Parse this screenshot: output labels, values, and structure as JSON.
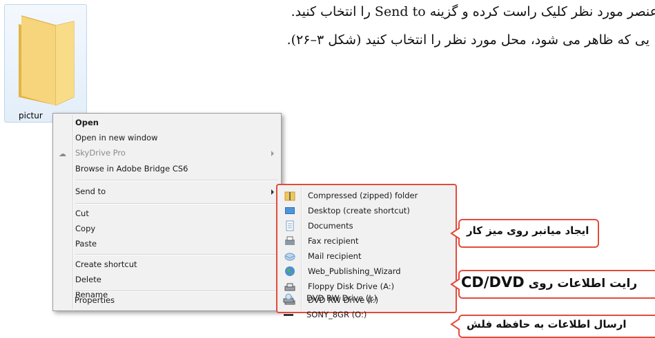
{
  "text": {
    "line1": "عنصر مورد نظر کلیک راست کرده و گزینه Send to را انتخاب کنید.",
    "line2": "یی که ظاهر می شود، محل مورد نظر را انتخاب کنید (شکل ۳–۲۶)."
  },
  "folder": {
    "caption": "pictur",
    "icon": "folder-icon"
  },
  "context_menu": {
    "items": [
      {
        "label": "Open",
        "bold": true
      },
      {
        "label": "Open in new window"
      },
      {
        "label": "SkyDrive Pro",
        "disabled": true,
        "submenu": true,
        "icon": "skydrive-icon"
      },
      {
        "label": "Browse in Adobe Bridge CS6"
      },
      {
        "label": "Send to",
        "submenu": true
      },
      {
        "label": "Cut"
      },
      {
        "label": "Copy"
      },
      {
        "label": "Paste"
      },
      {
        "label": "Create shortcut"
      },
      {
        "label": "Delete"
      },
      {
        "label": "Rename"
      },
      {
        "label": "Properties"
      }
    ]
  },
  "send_to_menu": {
    "items": [
      {
        "label": "Compressed (zipped) folder",
        "icon": "zip-folder-icon"
      },
      {
        "label": "Desktop (create shortcut)",
        "icon": "desktop-icon"
      },
      {
        "label": "Documents",
        "icon": "documents-icon"
      },
      {
        "label": "Fax recipient",
        "icon": "fax-icon"
      },
      {
        "label": "Mail recipient",
        "icon": "mail-icon"
      },
      {
        "label": "Web_Publishing_Wizard",
        "icon": "globe-icon"
      },
      {
        "label": "Floppy Disk Drive (A:)",
        "icon": "floppy-icon"
      },
      {
        "label": "DVD RW Drive (I:)",
        "icon": "dvd-drive-icon"
      },
      {
        "label": "DVD RW Drive (J:)",
        "icon": "dvd-drive-icon"
      },
      {
        "label": "SONY_8GR (O:)",
        "icon": "usb-drive-icon"
      }
    ]
  },
  "callouts": {
    "desktop": "ایجاد میانبر روی میز کار",
    "cd_prefix": "رایت اطلاعات روی",
    "cd_latin": "CD/DVD",
    "flash": "ارسال اطلاعات به حافظه فلش"
  },
  "colors": {
    "callout_border": "#e34a3a",
    "menu_bg": "#f1f1f1"
  }
}
